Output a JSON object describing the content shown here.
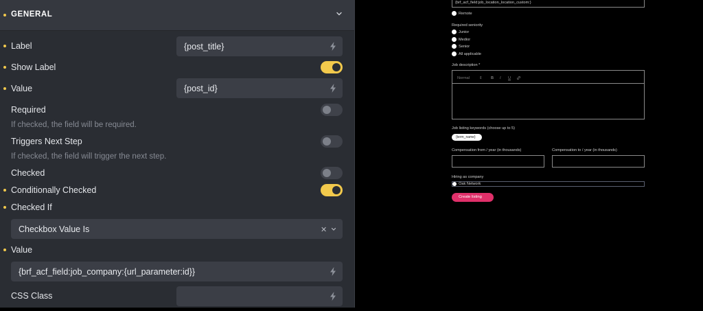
{
  "panel": {
    "section_title": "GENERAL",
    "label": {
      "name": "Label",
      "value": "{post_title}"
    },
    "show_label": {
      "name": "Show Label",
      "on": true
    },
    "value": {
      "name": "Value",
      "value": "{post_id}"
    },
    "required": {
      "name": "Required",
      "hint": "If checked, the field will be required.",
      "on": false
    },
    "triggers_next_step": {
      "name": "Triggers Next Step",
      "hint": "If checked, the field will trigger the next step.",
      "on": false
    },
    "checked": {
      "name": "Checked",
      "on": false
    },
    "conditionally_checked": {
      "name": "Conditionally Checked",
      "on": true
    },
    "checked_if": {
      "name": "Checked If",
      "selected": "Checkbox Value Is"
    },
    "value2": {
      "name": "Value",
      "value": "{brf_acf_field:job_company:{url_parameter:id}}"
    },
    "css_class": {
      "name": "CSS Class",
      "value": ""
    }
  },
  "preview": {
    "location_field_value": "{brf_acf_field:job_location_location_custom:}",
    "remote_option": "Remote",
    "seniority_label": "Required seniority",
    "seniority_options": [
      "Junior",
      "Medior",
      "Senior",
      "All applicable"
    ],
    "job_description_label": "Job description *",
    "editor_style": "Normal",
    "editor_tools": [
      "B",
      "I",
      "U"
    ],
    "keywords_label": "Job listing keywords (choose up to 5)",
    "keyword_chip": "{term_name}",
    "comp_from_label": "Compensation from / year (in thousands)",
    "comp_to_label": "Compensation to / year (in thousands)",
    "hiring_label": "Hiring as company",
    "company_option": "Oak Network",
    "create_button": "Create listing",
    "accent_color": "#e0306a"
  }
}
